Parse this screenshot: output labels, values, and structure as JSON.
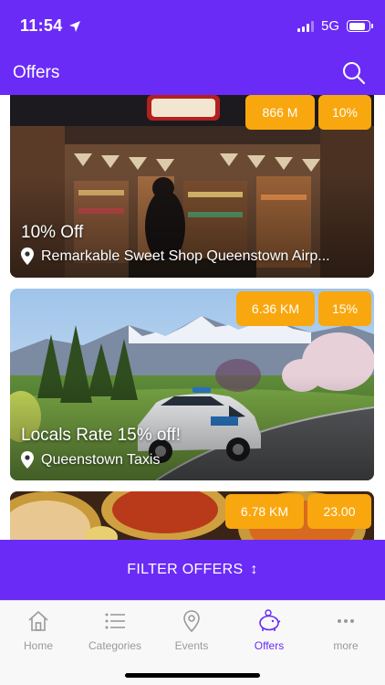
{
  "status_bar": {
    "time": "11:54",
    "network": "5G",
    "battery_level": 0.85,
    "signal_bars": 3
  },
  "header": {
    "title": "Offers"
  },
  "offers": [
    {
      "title": "10% Off",
      "location": "Remarkable Sweet Shop Queenstown Airp...",
      "distance": "866 M",
      "badge": "10%"
    },
    {
      "title": "Locals Rate 15% off!",
      "location": "Queenstown Taxis",
      "distance": "6.36 KM",
      "badge": "15%"
    },
    {
      "title": "",
      "location": "",
      "distance": "6.78 KM",
      "badge": "23.00"
    }
  ],
  "filter": {
    "label": "FILTER OFFERS",
    "icon": "↕"
  },
  "tabbar": {
    "items": [
      {
        "label": "Home",
        "icon": "home-icon",
        "active": false
      },
      {
        "label": "Categories",
        "icon": "list-icon",
        "active": false
      },
      {
        "label": "Events",
        "icon": "map-pin-icon",
        "active": false
      },
      {
        "label": "Offers",
        "icon": "piggy-bank-icon",
        "active": true
      },
      {
        "label": "more",
        "icon": "more-icon",
        "active": false
      }
    ]
  },
  "colors": {
    "primary": "#6A2BF6",
    "badge": "#F9A70E",
    "tab_inactive": "#9A9A9A"
  }
}
